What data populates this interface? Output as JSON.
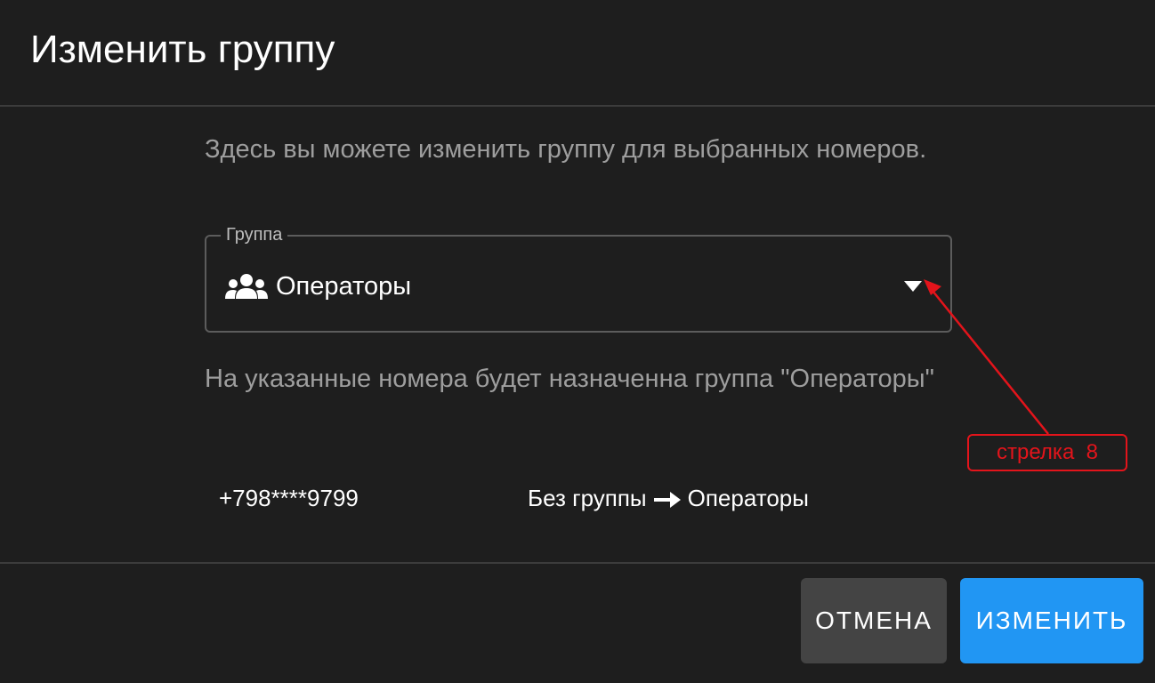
{
  "dialog": {
    "title": "Изменить группу",
    "description": "Здесь вы можете изменить группу для выбранных номеров.",
    "group_field": {
      "label": "Группа",
      "value": "Операторы",
      "icon": "group-users-icon"
    },
    "note": "На указанные номера будет назначенна группа \"Операторы\"",
    "changes": [
      {
        "phone": "+798****9799",
        "from": "Без группы",
        "to": "Операторы"
      }
    ],
    "buttons": {
      "cancel": "ОТМЕНА",
      "confirm": "ИЗМЕНИТЬ"
    }
  },
  "annotation": {
    "label": "стрелка  8",
    "color": "#e3141b"
  },
  "colors": {
    "background": "#1e1e1e",
    "accent": "#2196f3",
    "cancel_button": "#444444",
    "muted_text": "#9e9e9e"
  }
}
